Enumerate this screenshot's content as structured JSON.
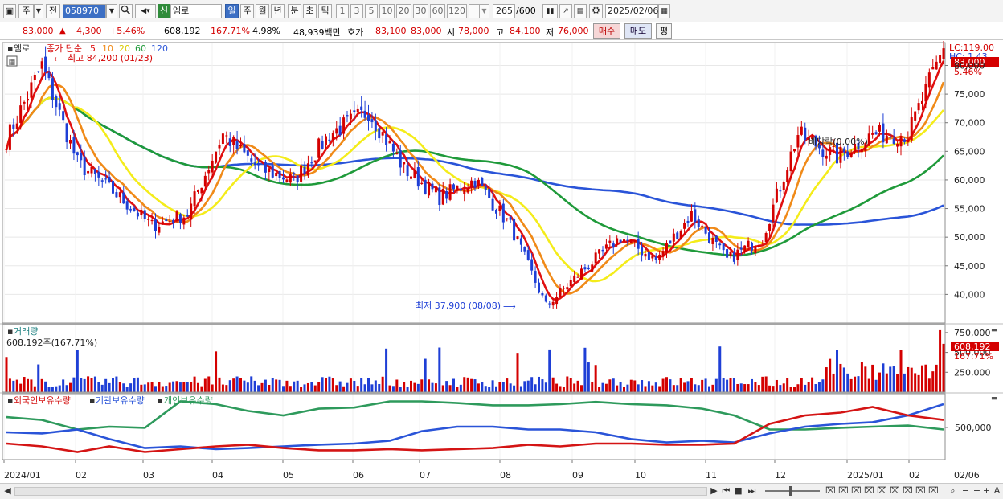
{
  "toolbar": {
    "market_label": "주",
    "prev_label": "전",
    "stock_code": "058970",
    "credit_badge": "신",
    "stock_name": "엠로",
    "periods": [
      "일",
      "주",
      "월",
      "년",
      "분",
      "초",
      "틱"
    ],
    "numbers": [
      "1",
      "3",
      "5",
      "10",
      "20",
      "30",
      "60",
      "120"
    ],
    "count": "265",
    "count_total": "/600",
    "date": "2025/02/06"
  },
  "quote": {
    "price": "83,000",
    "change": "4,300",
    "change_pct": "+5.46%",
    "volume": "608,192",
    "volume_ratio": "167.71%",
    "turnover": "4.98%",
    "amount": "48,939백만",
    "bid_label": "호가",
    "bid1": "83,100",
    "bid2": "83,000",
    "open_label": "시",
    "open": "78,000",
    "high_label": "고",
    "high": "84,100",
    "low_label": "저",
    "low": "76,000",
    "buy_label": "매수",
    "sell_label": "매도",
    "eval_label": "평"
  },
  "colors": {
    "up": "#d40000",
    "down": "#1e3fd6",
    "ma5": "#e01010",
    "ma10": "#f08a18",
    "ma20": "#f4ec1a",
    "ma60": "#1f9a3a",
    "ma120": "#2a54d8",
    "foreign": "#d41414",
    "institution": "#2a54d8",
    "individual": "#2e9a5c"
  },
  "price_panel": {
    "name": "엠로",
    "legend_label": "종가 단순",
    "ma_periods": [
      "5",
      "10",
      "20",
      "60",
      "120"
    ],
    "lc_label": "LC:119.00",
    "hc_label": "HC: 1.43",
    "last_price_tag": "83,000",
    "last_change_tag": "5.46%",
    "high_annotation": "최고 84,200 (01/23)",
    "low_annotation": "최저 37,900 (08/08)",
    "dividend_annotation": "배당락(0.00%)",
    "y_ticks": [
      "80,000",
      "75,000",
      "70,000",
      "65,000",
      "60,000",
      "55,000",
      "50,000",
      "45,000",
      "40,000"
    ]
  },
  "volume_panel": {
    "title": "거래량",
    "current": "608,192주(167.71%)",
    "tag_value": "608,192",
    "tag_pct": "167.71%",
    "y_ticks": [
      "750,000",
      "500,000",
      "250,000"
    ]
  },
  "holdings_panel": {
    "legend": [
      "외국인보유수량",
      "기관보유수량",
      "개인보유수량"
    ],
    "y_tick": "500,000"
  },
  "x_axis": {
    "labels": [
      "2024/01",
      "02",
      "03",
      "04",
      "05",
      "06",
      "07",
      "08",
      "09",
      "10",
      "11",
      "12",
      "2025/01",
      "02"
    ],
    "right_label": "02/06"
  },
  "chart_data": {
    "type": "candlestick",
    "x_range": [
      "2024/01",
      "2025/02/06"
    ],
    "price_ylim": [
      35000,
      84000
    ],
    "keypoints_close": [
      [
        "2024/01 start",
        67000
      ],
      [
        "2024/01/23",
        80000
      ],
      [
        "2024/02 early",
        63000
      ],
      [
        "2024/02 mid",
        58000
      ],
      [
        "2024/03 mid",
        52000
      ],
      [
        "2024/04 start",
        54000
      ],
      [
        "2024/04 mid",
        68000
      ],
      [
        "2024/04 end",
        62000
      ],
      [
        "2024/05 start",
        60000
      ],
      [
        "2024/05 end",
        68000
      ],
      [
        "2024/06 start",
        72000
      ],
      [
        "2024/06 mid",
        62000
      ],
      [
        "2024/07 start",
        57000
      ],
      [
        "2024/07 mid",
        60000
      ],
      [
        "2024/07 end",
        52000
      ],
      [
        "2024/08/08",
        38000
      ],
      [
        "2024/08 end",
        44000
      ],
      [
        "2024/09 start",
        50000
      ],
      [
        "2024/09 mid",
        46000
      ],
      [
        "2024/10 start",
        54000
      ],
      [
        "2024/10 end",
        46000
      ],
      [
        "2024/11 start",
        50000
      ],
      [
        "2024/11 mid",
        68000
      ],
      [
        "2024/12",
        64000
      ],
      [
        "2025/01",
        68000
      ],
      [
        "2025/02/03",
        68000
      ],
      [
        "2025/02/06",
        83000
      ]
    ],
    "volume_ylim": [
      0,
      850000
    ],
    "volume_last": 608192,
    "holdings_series": [
      "외국인보유수량",
      "기관보유수량",
      "개인보유수량"
    ]
  }
}
